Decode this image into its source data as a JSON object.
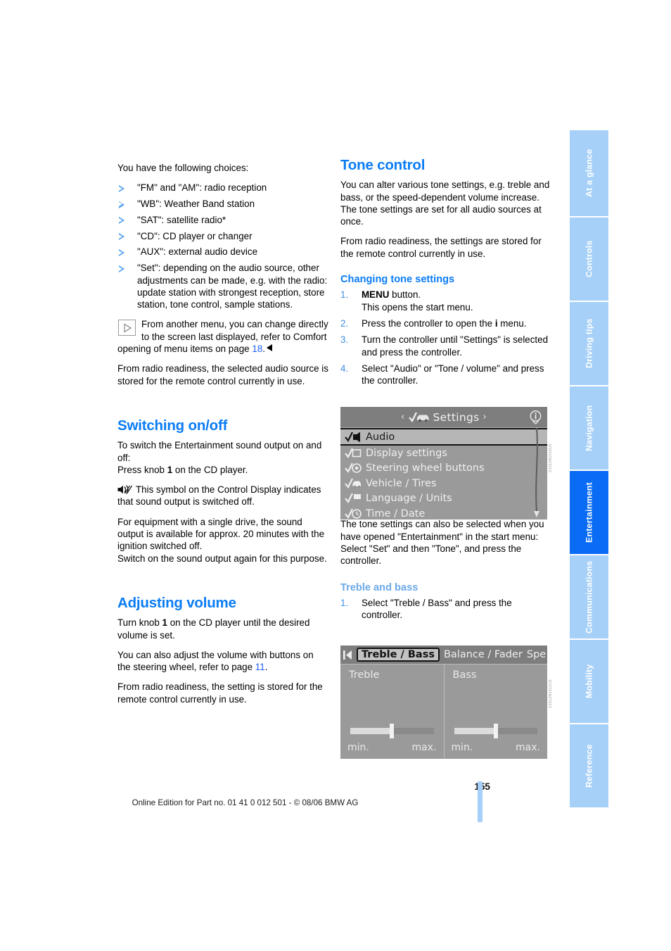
{
  "left_column": {
    "intro": "You have the following choices:",
    "choices": [
      "\"FM\" and \"AM\": radio reception",
      "\"WB\": Weather Band station",
      "\"SAT\": satellite radio*",
      "\"CD\": CD player or changer",
      "\"AUX\": external audio device",
      "\"Set\": depending on the audio source, other adjustments can be made, e.g. with the radio: update station with strongest reception, store station, tone control, sample stations."
    ],
    "note": {
      "text_before_page": "From another menu, you can change directly to the screen last displayed, refer to Comfort opening of menu items on page ",
      "page_ref": "18",
      "text_after_page": "."
    },
    "radio_readiness": "From radio readiness, the selected audio source is stored for the remote control currently in use.",
    "switching": {
      "heading": "Switching on/off",
      "p1_line1": "To switch the Entertainment sound output on and off:",
      "p1_line2_pre": "Press knob ",
      "p1_line2_bold": "1",
      "p1_line2_post": " on the CD player.",
      "p2": "This symbol on the Control Display indicates that sound output is switched off.",
      "p3_line1": "For equipment with a single drive, the sound output is available for approx. 20 minutes with the ignition switched off.",
      "p3_line2": "Switch on the sound output again for this purpose."
    },
    "volume": {
      "heading": "Adjusting volume",
      "p1_pre": "Turn knob ",
      "p1_bold": "1",
      "p1_post": " on the CD player until the desired volume is set.",
      "p2_pre": "You can also adjust the volume with buttons on the steering wheel, refer to page ",
      "p2_page_ref": "11",
      "p2_post": ".",
      "p3": "From radio readiness, the setting is stored for the remote control currently in use."
    }
  },
  "right_column": {
    "tone_control": {
      "heading": "Tone control",
      "p1_line1": "You can alter various tone settings, e.g. treble and bass, or the speed-dependent volume increase.",
      "p1_line2": "The tone settings are set for all audio sources at once.",
      "p2": "From radio readiness, the settings are stored for the remote control currently in use."
    },
    "changing_tone_settings": {
      "heading": "Changing tone settings",
      "steps": [
        {
          "num": "1.",
          "pre": "",
          "bold": "MENU",
          "post": " button.",
          "line2": "This opens the start menu."
        },
        {
          "num": "2.",
          "pre": "Press the controller to open the ",
          "bold": "i",
          "post": " menu.",
          "line2": ""
        },
        {
          "num": "3.",
          "pre": "Turn the controller until \"Settings\" is selected and press the controller.",
          "bold": "",
          "post": "",
          "line2": ""
        },
        {
          "num": "4.",
          "pre": "Select \"Audio\" or \"Tone / volume\" and press the controller.",
          "bold": "",
          "post": "",
          "line2": ""
        }
      ]
    },
    "after_settings": {
      "line1": "The tone settings can also be selected when you have opened \"Entertainment\" in the start menu:",
      "line2": "Select \"Set\" and then \"Tone\", and press the controller."
    },
    "treble_and_bass": {
      "heading": "Treble and bass",
      "steps": [
        {
          "num": "1.",
          "text": "Select \"Treble / Bass\" and press the controller."
        }
      ]
    }
  },
  "settings_screen": {
    "title": "Settings",
    "left_arrow": "‹",
    "right_arrow": "›",
    "info_icon": "info-button-icon",
    "items": [
      {
        "label": "Audio",
        "selected": true,
        "icon": "audio-speaker-icon"
      },
      {
        "label": "Display settings",
        "selected": false,
        "icon": "display-icon"
      },
      {
        "label": "Steering wheel buttons",
        "selected": false,
        "icon": "steering-wheel-icon"
      },
      {
        "label": "Vehicle / Tires",
        "selected": false,
        "icon": "vehicle-icon"
      },
      {
        "label": "Language / Units",
        "selected": false,
        "icon": "flag-icon"
      },
      {
        "label": "Time / Date",
        "selected": false,
        "icon": "clock-icon"
      }
    ],
    "figure_id": "S1612N1510US"
  },
  "treble_bass_screen": {
    "tabs": [
      {
        "label": "Treble / Bass",
        "selected": true
      },
      {
        "label": "Balance / Fader",
        "selected": false
      },
      {
        "label": "Spe",
        "selected": false
      }
    ],
    "left_nav_icon": "nav-left-icon",
    "right_nav_icon": "nav-right-icon",
    "info_icon": "info-button-icon",
    "panels": [
      {
        "label": "Treble",
        "min": "min.",
        "max": "max.",
        "value_percent": 50
      },
      {
        "label": "Bass",
        "min": "min.",
        "max": "max.",
        "value_percent": 50
      }
    ],
    "figure_id": "S1612N1512US"
  },
  "sidebar": {
    "tabs": [
      {
        "label": "At a glance",
        "active": false
      },
      {
        "label": "Controls",
        "active": false
      },
      {
        "label": "Driving tips",
        "active": false
      },
      {
        "label": "Navigation",
        "active": false
      },
      {
        "label": "Entertainment",
        "active": true
      },
      {
        "label": "Communications",
        "active": false
      },
      {
        "label": "Mobility",
        "active": false
      },
      {
        "label": "Reference",
        "active": false
      }
    ]
  },
  "footer": {
    "page_number": "155",
    "edition_text": "Online Edition for Part no. 01 41 0 012 501 - © 08/06 BMW AG"
  },
  "colors": {
    "heading_blue": "#0a7cf5",
    "light_blue": "#6ba9e8",
    "link_blue": "#1a5ff0",
    "tab_blue": "#a6d0f7",
    "tab_active_blue": "#0a6cf5"
  }
}
